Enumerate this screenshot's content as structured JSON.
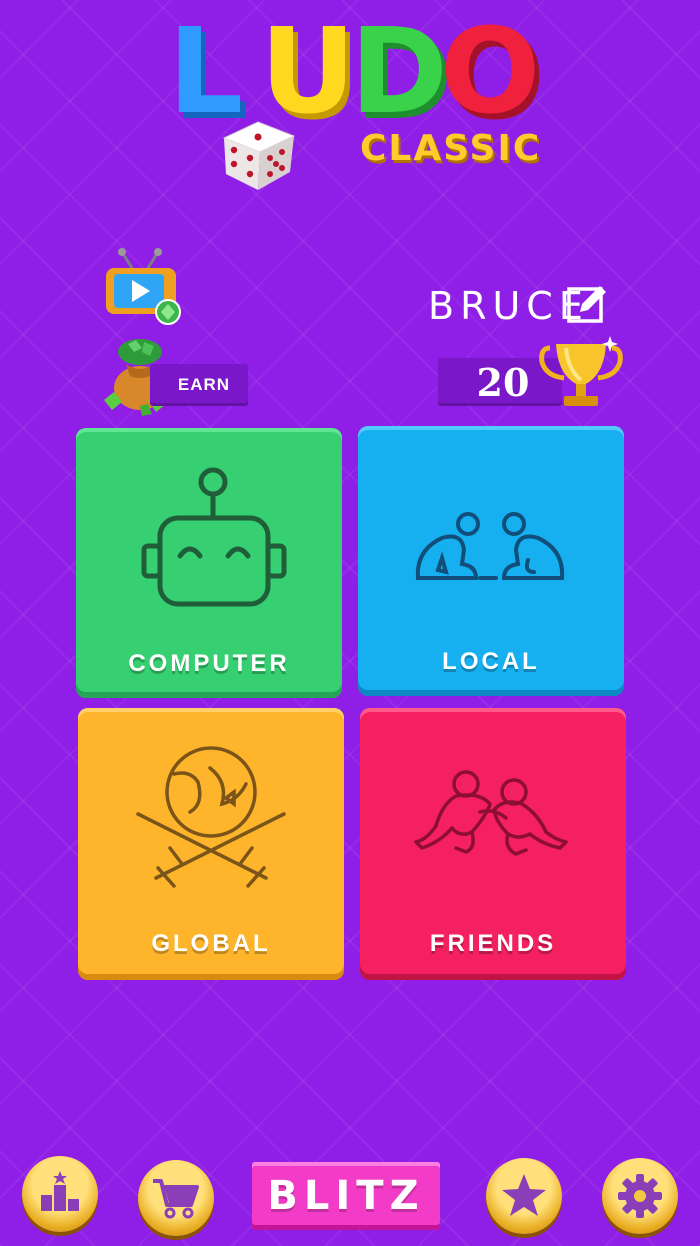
{
  "logo": {
    "letters": [
      "L",
      "U",
      "D",
      "O"
    ],
    "subtitle": "CLASSIC"
  },
  "earn": {
    "label": "EARN"
  },
  "player": {
    "name": "BRUCE",
    "trophies": "20"
  },
  "modes": {
    "computer": {
      "label": "COMPUTER",
      "color": "#36d072"
    },
    "local": {
      "label": "LOCAL",
      "color": "#16b0f1"
    },
    "global": {
      "label": "GLOBAL",
      "color": "#ffb52b"
    },
    "friends": {
      "label": "FRIENDS",
      "color": "#f5205f"
    }
  },
  "bottom_bar": {
    "blitz_label": "BLITZ",
    "icons": [
      "leaderboard-icon",
      "cart-icon",
      "star-icon",
      "gear-icon"
    ]
  },
  "colors": {
    "background": "#8f1fe6",
    "panel": "#7a17c9",
    "blitz": "#f23bc7",
    "gold": "#ffcc2e"
  }
}
